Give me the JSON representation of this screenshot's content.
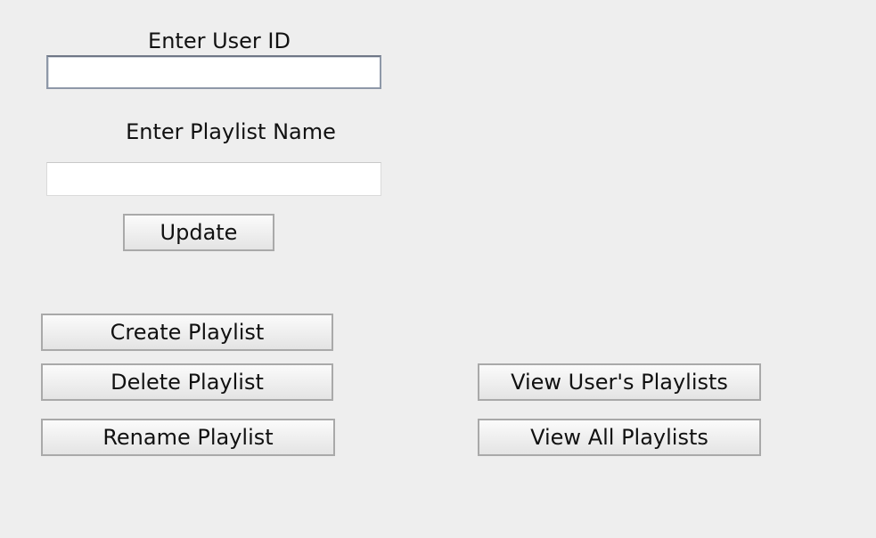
{
  "form": {
    "user_id_label": "Enter User ID",
    "user_id_value": "",
    "playlist_name_label": "Enter Playlist Name",
    "playlist_name_value": "",
    "update_label": "Update"
  },
  "actions": {
    "create_label": "Create Playlist",
    "delete_label": "Delete Playlist",
    "rename_label": "Rename Playlist",
    "view_user_label": "View User's Playlists",
    "view_all_label": "View All Playlists"
  },
  "colors": {
    "background": "#eeeeee",
    "button_border": "#a9a9a9",
    "focused_field_border": "#8e98a8"
  }
}
